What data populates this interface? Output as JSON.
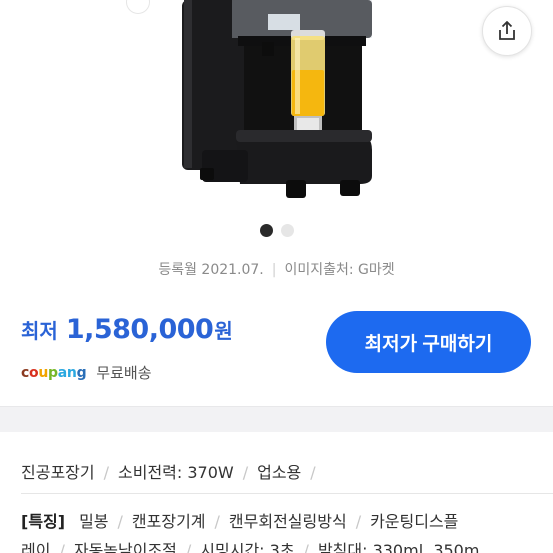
{
  "product_image": {
    "icons": {
      "share": "share-icon"
    }
  },
  "carousel": {
    "count": 2,
    "active_index": 0
  },
  "meta": {
    "registered": "등록월 2021.07.",
    "image_source": "이미지출처: G마켓"
  },
  "price": {
    "label": "최저",
    "value": "1,580,000",
    "unit": "원",
    "color": "#2a63d6"
  },
  "seller": {
    "logo_text": "coupang",
    "shipping": "무료배송"
  },
  "buy_button": {
    "label": "최저가 구매하기",
    "color": "#1d6af0"
  },
  "specs": {
    "line1": [
      "진공포장기",
      "소비전력: 370W",
      "업소용"
    ],
    "features_tag": "[특징]",
    "line2": [
      "밀봉",
      "캔포장기계",
      "캔무회전실링방식",
      "카운팅디스플"
    ],
    "line3": [
      "레이",
      "자동높낮이조절",
      "시밍시간: 3초",
      "받침대: 330ml, 350m"
    ]
  }
}
